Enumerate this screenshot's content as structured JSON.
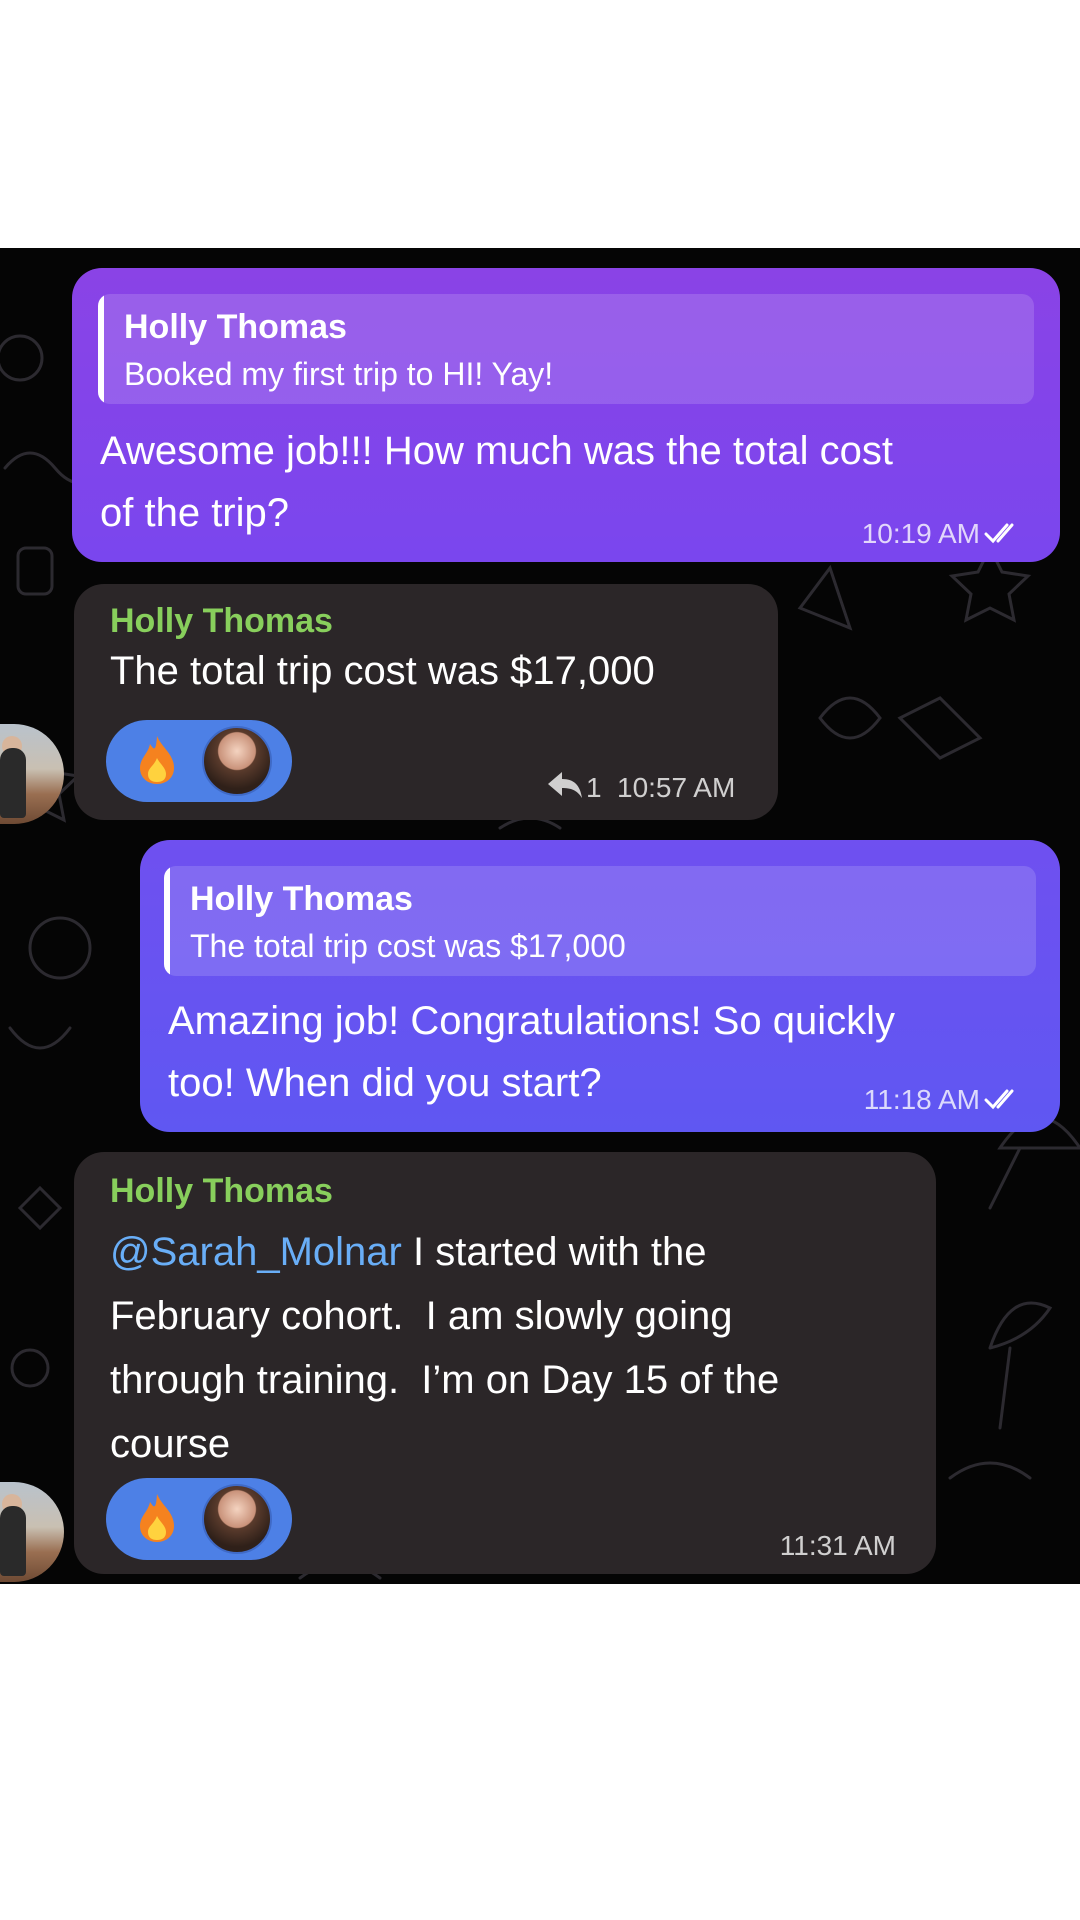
{
  "colors": {
    "outgoing_top": "#8a43e6",
    "outgoing_bottom": "#5f57f2",
    "incoming": "#2b2628",
    "sender_name": "#88cf5c",
    "mention": "#69aef7",
    "reaction_pill": "#4d80e6",
    "chat_background": "#050505"
  },
  "messages": [
    {
      "direction": "outgoing",
      "reply_to": {
        "name": "Holly Thomas",
        "text": "Booked my first trip to HI! Yay!"
      },
      "text_lines": [
        "Awesome job!!! How much was the total cost",
        "of the trip?"
      ],
      "time": "10:19 AM",
      "status_icon": "double-check-icon"
    },
    {
      "direction": "incoming",
      "sender": "Holly Thomas",
      "text": "The total trip cost was $17,000",
      "reaction": {
        "emoji": "🔥",
        "icon": "fire-icon"
      },
      "reply_count": "1",
      "reply_icon": "reply-arrow-icon",
      "time": "10:57 AM"
    },
    {
      "direction": "outgoing",
      "reply_to": {
        "name": "Holly Thomas",
        "text": "The total trip cost was $17,000"
      },
      "text_lines": [
        "Amazing job! Congratulations! So quickly",
        "too! When did you start?"
      ],
      "time": "11:18 AM",
      "status_icon": "double-check-icon"
    },
    {
      "direction": "incoming",
      "sender": "Holly Thomas",
      "mention": "@Sarah_Molnar",
      "text_lines": [
        " I started with the",
        "February cohort.  I am slowly going",
        "through training.  I’m on Day 15 of the",
        "course"
      ],
      "reaction": {
        "emoji": "🔥",
        "icon": "fire-icon"
      },
      "time": "11:31 AM"
    }
  ]
}
